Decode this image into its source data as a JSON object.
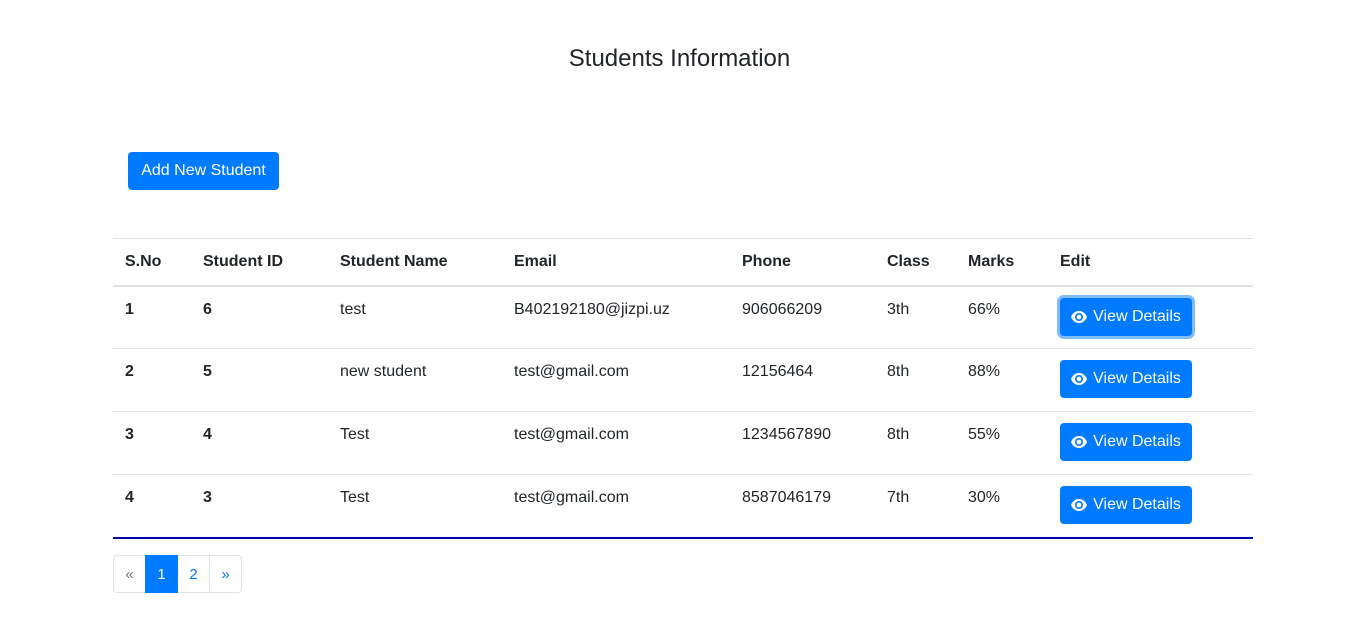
{
  "page": {
    "title": "Students Information"
  },
  "toolbar": {
    "add_label": "Add New Student"
  },
  "table": {
    "headers": [
      "S.No",
      "Student ID",
      "Student Name",
      "Email",
      "Phone",
      "Class",
      "Marks",
      "Edit"
    ],
    "rows": [
      {
        "sno": "1",
        "id": "6",
        "name": "test",
        "email": "B402192180@jizpi.uz",
        "phone": "906066209",
        "class": "3th",
        "marks": "66%",
        "action": "View Details"
      },
      {
        "sno": "2",
        "id": "5",
        "name": "new student",
        "email": "test@gmail.com",
        "phone": "12156464",
        "class": "8th",
        "marks": "88%",
        "action": "View Details"
      },
      {
        "sno": "3",
        "id": "4",
        "name": "Test",
        "email": "test@gmail.com",
        "phone": "1234567890",
        "class": "8th",
        "marks": "55%",
        "action": "View Details"
      },
      {
        "sno": "4",
        "id": "3",
        "name": "Test",
        "email": "test@gmail.com",
        "phone": "8587046179",
        "class": "7th",
        "marks": "30%",
        "action": "View Details"
      }
    ]
  },
  "pagination": {
    "prev": "«",
    "pages": [
      "1",
      "2"
    ],
    "active": "1",
    "next": "»"
  },
  "colors": {
    "primary": "#007bff",
    "table_bottom_border": "#0000b3",
    "text": "#212529"
  },
  "icons": {
    "view": "eye-icon"
  }
}
